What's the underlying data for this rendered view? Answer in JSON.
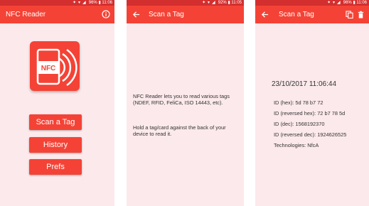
{
  "status_bar": {
    "screen1": {
      "battery": "96%",
      "time": "11:06"
    },
    "screen2": {
      "battery": "92%",
      "time": "11:05"
    },
    "screen3": {
      "battery": "96%",
      "time": "11:06"
    }
  },
  "main_screen": {
    "title": "NFC Reader",
    "app_icon_label": "NFC",
    "buttons": {
      "scan": "Scan a Tag",
      "history": "History",
      "prefs": "Prefs"
    }
  },
  "scan_screen": {
    "title": "Scan a Tag",
    "description": "NFC Reader lets you to read various tags (NDEF, RFID, FeliCa, ISO 14443, etc).",
    "instruction": "Hold a tag/card against the back of your device to read it."
  },
  "result_screen": {
    "title": "Scan a Tag",
    "timestamp": "23/10/2017 11:06:44",
    "rows": [
      "ID (hex): 5d 78 b7 72",
      "ID (reversed hex): 72 b7 78 5d",
      "ID (dec): 1568192370",
      "ID (reversed dec): 1924626525",
      "Technologies: NfcA"
    ]
  },
  "colors": {
    "primary": "#f44336",
    "status_bar": "#d32f2f",
    "background": "#fce9eb"
  },
  "icons": [
    "info-icon",
    "back-arrow-icon",
    "copy-icon",
    "delete-icon",
    "nfc-app-icon"
  ]
}
